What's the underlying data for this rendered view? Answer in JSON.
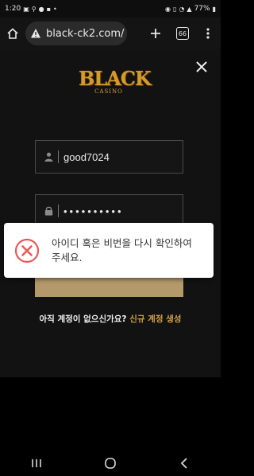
{
  "status_bar": {
    "time": "1:20",
    "battery": "77%"
  },
  "browser": {
    "url": "black-ck2.com/",
    "tabs_count": "66"
  },
  "logo": {
    "word": "BLACK",
    "sub": "CASINO"
  },
  "login": {
    "username_value": "good7024",
    "password_mask": "••••••••••"
  },
  "signup": {
    "question": "아직 계정이 없으신가요?",
    "link": "신규 계정 생성"
  },
  "alert": {
    "message": "아이디 혹은 비번을 다시 확인하여 주세요."
  },
  "colors": {
    "accent": "#d1a24a",
    "button": "#b49a6a",
    "error": "#e85a5a"
  }
}
